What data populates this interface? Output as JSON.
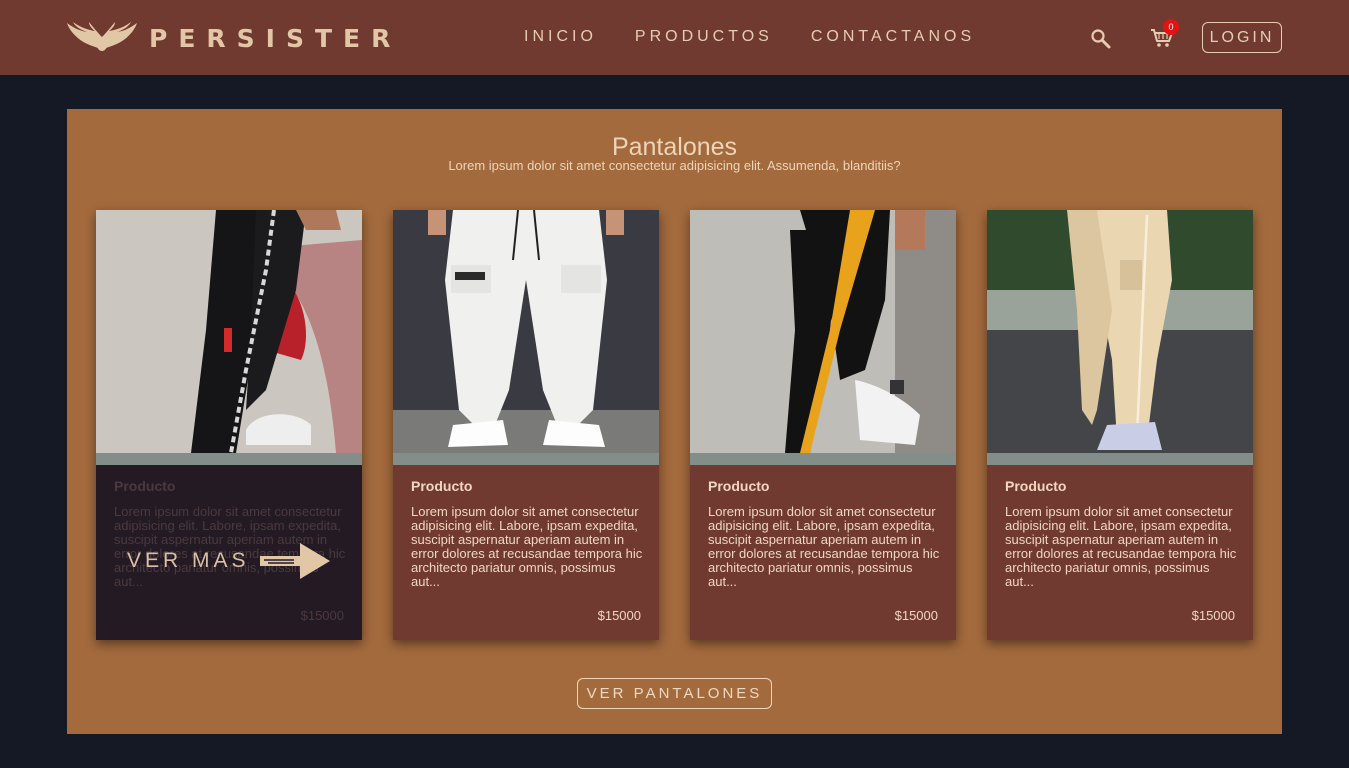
{
  "header": {
    "brand": "PERSISTER",
    "nav": [
      "INICIO",
      "PRODUCTOS",
      "CONTACTANOS"
    ],
    "cart_count": "0",
    "login_label": "LOGIN"
  },
  "section": {
    "title": "Pantalones",
    "subtitle": "Lorem ipsum dolor sit amet consectetur adipisicing elit. Assumenda, blanditiis?",
    "cards": [
      {
        "title": "Producto",
        "description": "Lorem ipsum dolor sit amet consectetur adipisicing elit. Labore, ipsam expedita, suscipit aspernatur aperiam autem in error dolores at recusandae tempora hic architecto pariatur omnis, possimus aut...",
        "price": "$15000"
      },
      {
        "title": "Producto",
        "description": "Lorem ipsum dolor sit amet consectetur adipisicing elit. Labore, ipsam expedita, suscipit aspernatur aperiam autem in error dolores at recusandae tempora hic architecto pariatur omnis, possimus aut...",
        "price": "$15000"
      },
      {
        "title": "Producto",
        "description": "Lorem ipsum dolor sit amet consectetur adipisicing elit. Labore, ipsam expedita, suscipit aspernatur aperiam autem in error dolores at recusandae tempora hic architecto pariatur omnis, possimus aut...",
        "price": "$15000"
      },
      {
        "title": "Producto",
        "description": "Lorem ipsum dolor sit amet consectetur adipisicing elit. Labore, ipsam expedita, suscipit aspernatur aperiam autem in error dolores at recusandae tempora hic architecto pariatur omnis, possimus aut...",
        "price": "$15000"
      }
    ],
    "hover_label": "VER MAS",
    "cta_label": "VER PANTALONES"
  },
  "icons": {
    "logo": "wings-logo-icon",
    "search": "search-icon",
    "cart": "cart-icon",
    "arrow": "arrow-right-icon"
  },
  "colors": {
    "header_bg": "#703a30",
    "page_bg": "#151825",
    "section_bg": "#a36a3d",
    "card_bg": "#703a30",
    "badge": "#e41212"
  }
}
